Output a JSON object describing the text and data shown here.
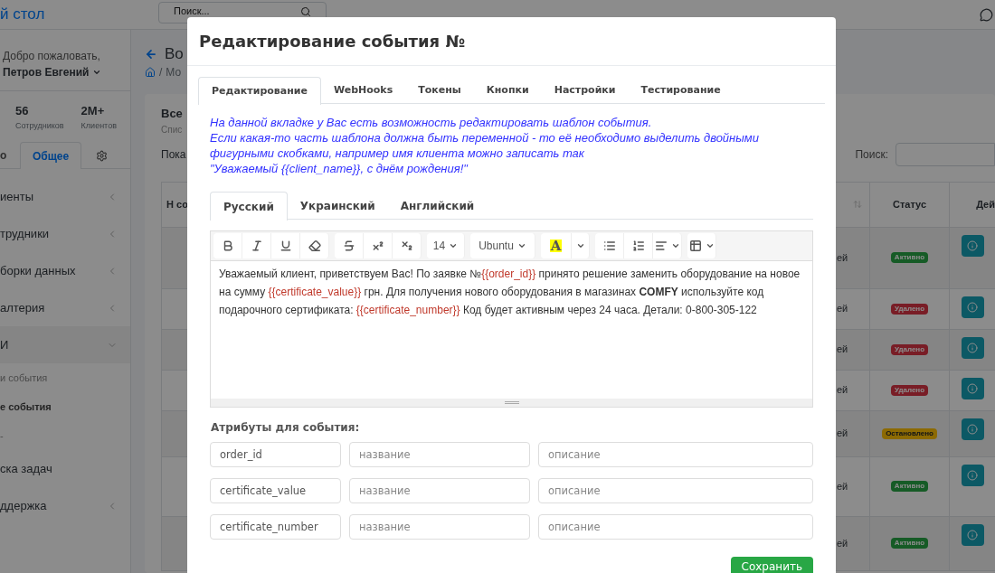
{
  "topbar": {
    "title": "й стол",
    "search_placeholder": "Поиск..."
  },
  "sidebar": {
    "greeting": "Добро пожаловать,",
    "user": "Петров Евгений",
    "stats": [
      {
        "value": "56",
        "label": "Сотрудников"
      },
      {
        "value": "2M+",
        "label": "Клиентов"
      }
    ],
    "tabs": [
      {
        "kind": "text",
        "label": "о",
        "selected": false
      },
      {
        "kind": "text",
        "label": "Общее",
        "selected": true
      },
      {
        "kind": "settings",
        "selected": false
      }
    ],
    "menu": [
      {
        "kind": "group",
        "label": "иенты",
        "expanded": false
      },
      {
        "kind": "group",
        "label": "трудники",
        "expanded": false
      },
      {
        "kind": "group",
        "label": "борки данных",
        "expanded": false
      },
      {
        "kind": "group",
        "label": "алтерия",
        "expanded": false
      },
      {
        "kind": "group",
        "label": "И",
        "expanded": true,
        "children": [
          {
            "label": "и события",
            "selected": false
          },
          {
            "label": "е события",
            "selected": true
          },
          {
            "label": "-",
            "selected": false
          }
        ]
      },
      {
        "kind": "link",
        "label": "ска задач"
      },
      {
        "kind": "group",
        "label": "ддержка",
        "expanded": false
      }
    ]
  },
  "main": {
    "title": "Во",
    "breadcrumb_separator": "/",
    "breadcrumb": "Мо",
    "card_title": "Все",
    "card_subtitle": "Спис",
    "show_label": "Пока",
    "search_label": "Поиск:",
    "table": {
      "column_1": "Н со",
      "status_header": "Статус",
      "actions_header": "Дей",
      "rows": [
        {
          "column_5": "ей",
          "status": {
            "kind": "active",
            "label": "Активно"
          }
        },
        {
          "column_5": "ей",
          "status": {
            "kind": "deleted",
            "label": "Удалено"
          }
        },
        {
          "column_5": "ей",
          "status": {
            "kind": "deleted",
            "label": "Удалено"
          }
        },
        {
          "column_5": "ей",
          "status": {
            "kind": "deleted",
            "label": "Удалено"
          }
        },
        {
          "column_5": "ей",
          "status": {
            "kind": "stopped",
            "label": "Остановлено"
          }
        },
        {
          "column_5": "ей",
          "status": {
            "kind": "active",
            "label": "Активно"
          }
        },
        {
          "column_5": "ей",
          "status": {
            "kind": "active",
            "label": "Активно"
          }
        }
      ]
    }
  },
  "modal": {
    "title": "Редактирование события №",
    "tabs": [
      {
        "label": "Редактирование",
        "selected": true
      },
      {
        "label": "WebHooks",
        "selected": false
      },
      {
        "label": "Токены",
        "selected": false
      },
      {
        "label": "Кнопки",
        "selected": false
      },
      {
        "label": "Настройки",
        "selected": false
      },
      {
        "label": "Тестирование",
        "selected": false
      }
    ],
    "info": [
      "На данной вкладке у Вас есть возможность редактировать шаблон события.",
      "Если какая-то часть шаблона должна быть переменной - то её необходимо выделить двойными фигурными скобками, например имя клиента можно записать так",
      "\"Уважаемый {{client_name}}, с днём рождения!\""
    ],
    "languages": [
      {
        "label": "Русский",
        "selected": true
      },
      {
        "label": "Украинский",
        "selected": false
      },
      {
        "label": "Английский",
        "selected": false
      }
    ],
    "toolbar": [
      [
        {
          "kind": "bold"
        },
        {
          "kind": "italic"
        },
        {
          "kind": "underline"
        },
        {
          "kind": "eraser"
        }
      ],
      [
        {
          "kind": "strike"
        },
        {
          "kind": "superscript"
        },
        {
          "kind": "subscript"
        }
      ],
      [
        {
          "kind": "size",
          "label": "14"
        }
      ],
      [
        {
          "kind": "font",
          "label": "Ubuntu"
        }
      ],
      [
        {
          "kind": "highlight",
          "label": "A"
        },
        {
          "kind": "caret"
        }
      ],
      [
        {
          "kind": "bullets"
        },
        {
          "kind": "numbers"
        },
        {
          "kind": "align"
        }
      ],
      [
        {
          "kind": "table"
        }
      ]
    ],
    "content": [
      {
        "kind": "plain",
        "text": "Уважаемый клиент, приветствуем Вас! По заявке №"
      },
      {
        "kind": "variable",
        "text": "{{order_id}}"
      },
      {
        "kind": "plain",
        "text": " принято решение заменить оборудование на новое на сумму "
      },
      {
        "kind": "variable",
        "text": "{{certificate_value}}"
      },
      {
        "kind": "plain",
        "text": " грн. Для получения нового оборудования в магазинах "
      },
      {
        "kind": "bold",
        "text": "COMFY"
      },
      {
        "kind": "plain",
        "text": " используйте код подарочного сертификата: "
      },
      {
        "kind": "variable",
        "text": "{{certificate_number}}"
      },
      {
        "kind": "plain",
        "text": " Код будет активным через 24 часа. Детали: 0-800-305-122"
      }
    ],
    "attributes_label": "Атрибуты для события:",
    "attributes": [
      {
        "key": "order_id",
        "name_placeholder": "название",
        "description_placeholder": "описание"
      },
      {
        "key": "certificate_value",
        "name_placeholder": "название",
        "description_placeholder": "описание"
      },
      {
        "key": "certificate_number",
        "name_placeholder": "название",
        "description_placeholder": "описание"
      }
    ],
    "save": "Сохранить"
  }
}
